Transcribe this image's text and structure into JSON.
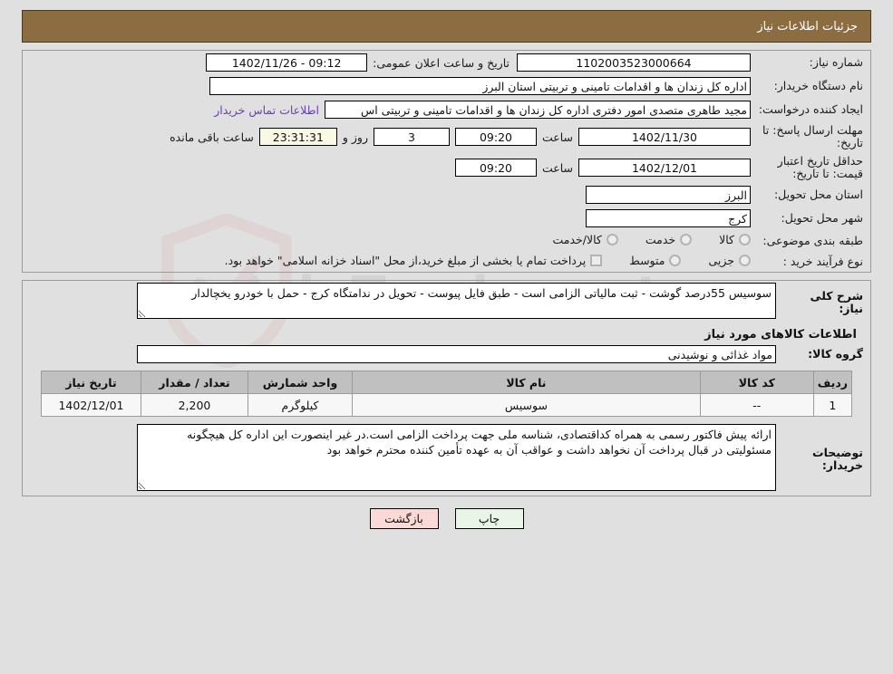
{
  "header": {
    "title": "جزئیات اطلاعات نیاز"
  },
  "watermark": {
    "text": "AriaTender.net"
  },
  "form": {
    "need_number_label": "شماره نیاز:",
    "need_number_value": "1102003523000664",
    "announce_label": "تاریخ و ساعت اعلان عمومی:",
    "announce_value": "09:12 - 1402/11/26",
    "buyer_org_label": "نام دستگاه خریدار:",
    "buyer_org_value": "اداره کل زندان ها و اقدامات تامینی و تربیتی استان البرز",
    "creator_label": "ایجاد کننده درخواست:",
    "creator_value": "مجید طاهری متصدی امور دفتری اداره کل زندان ها و اقدامات تامینی و تربیتی اس",
    "contact_link": "اطلاعات تماس خریدار",
    "deadline_label": "مهلت ارسال پاسخ: تا تاریخ:",
    "deadline_date": "1402/11/30",
    "hour_label": "ساعت",
    "deadline_time": "09:20",
    "days_value": "3",
    "days_label": "روز و",
    "timer_value": "23:31:31",
    "remaining_label": "ساعت باقی مانده",
    "validity_label": "حداقل تاریخ اعتبار قیمت: تا تاریخ:",
    "validity_date": "1402/12/01",
    "validity_time": "09:20",
    "province_label": "استان محل تحویل:",
    "province_value": "البرز",
    "city_label": "شهر محل تحویل:",
    "city_value": "کرج",
    "category_label": "طبقه بندی موضوعی:",
    "category_options": [
      "کالا",
      "خدمت",
      "کالا/خدمت"
    ],
    "process_label": "نوع فرآیند خرید :",
    "process_options": [
      "جزیی",
      "متوسط"
    ],
    "treasury_note": "پرداخت تمام یا بخشی از مبلغ خرید،از محل \"اسناد خزانه اسلامی\" خواهد بود."
  },
  "description": {
    "label": "شرح کلی نیاز:",
    "value": "سوسیس 55درصد گوشت - ثبت مالیاتی الزامی است - طبق فایل پیوست - تحویل در ندامتگاه کرج - حمل با خودرو یخچالدار"
  },
  "goods_section": {
    "title": "اطلاعات کالاهای مورد نیاز",
    "group_label": "گروه کالا:",
    "group_value": "مواد غذائی و نوشیدنی",
    "columns": [
      "ردیف",
      "کد کالا",
      "نام کالا",
      "واحد شمارش",
      "تعداد / مقدار",
      "تاریخ نیاز"
    ],
    "rows": [
      {
        "row": "1",
        "code": "--",
        "name": "سوسیس",
        "unit": "کیلوگرم",
        "qty": "2,200",
        "date": "1402/12/01"
      }
    ]
  },
  "notes": {
    "label": "توضیحات خریدار:",
    "value": "ارائه پیش فاکتور رسمی به همراه کداقتصادی، شناسه ملی جهت پرداخت الزامی است.در غیر اینصورت این اداره کل هیچگونه مسئولیتی در قبال پرداخت آن نخواهد داشت و عواقب آن به عهده تأمین کننده محترم خواهد بود"
  },
  "buttons": {
    "print": "چاپ",
    "return": "بازگشت"
  },
  "colors": {
    "header_bg": "#8c6d42",
    "page_bg": "#e0e0e0",
    "table_header_bg": "#c0c0c0",
    "link": "#6a3fb5",
    "timer_bg": "#faf9e6",
    "print_btn_bg": "#e9f5e6",
    "return_btn_bg": "#fbd9d6"
  }
}
